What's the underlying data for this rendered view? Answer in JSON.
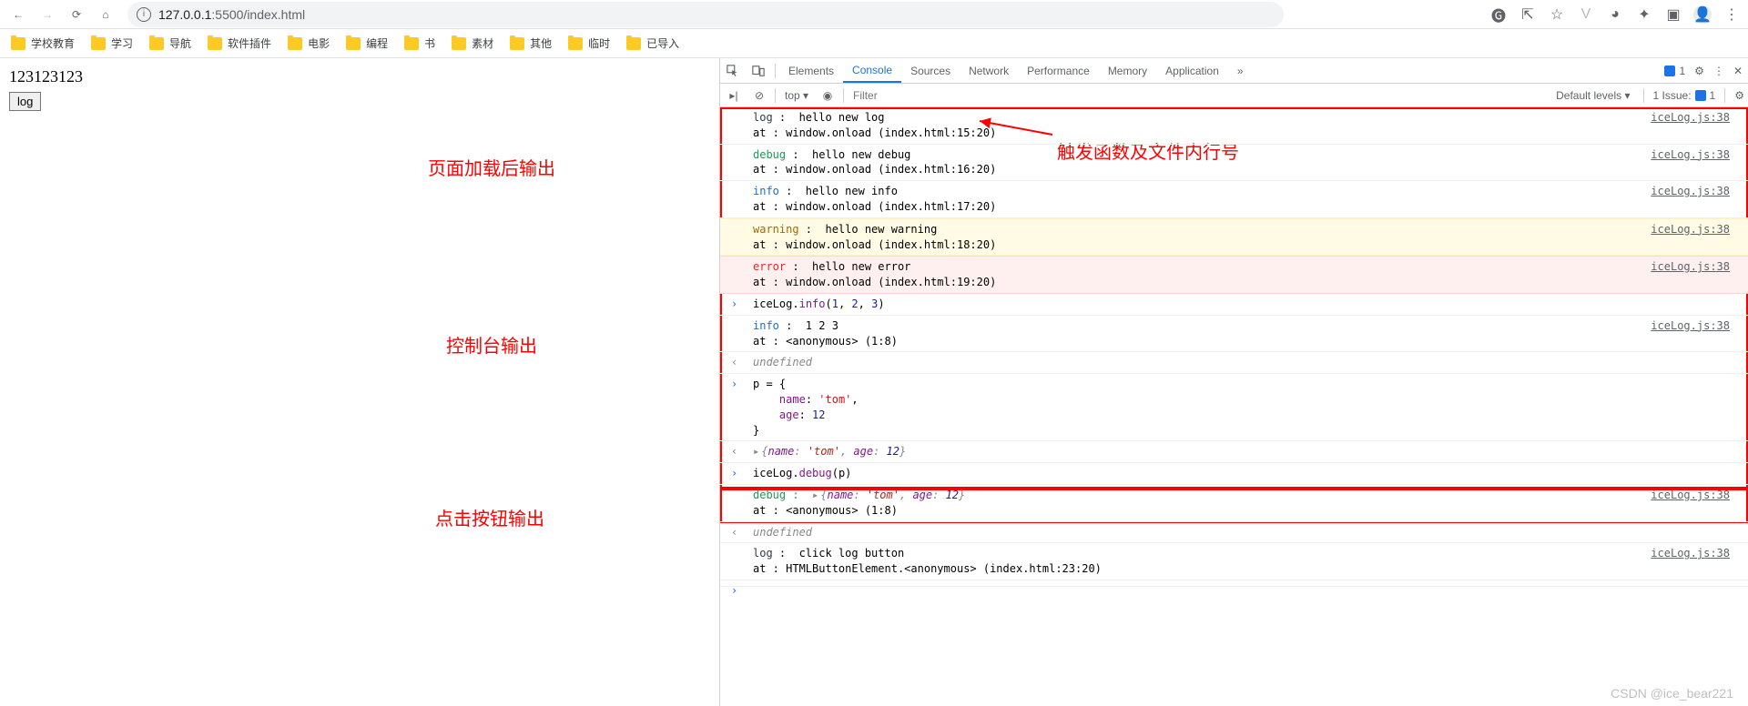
{
  "browser": {
    "url_prefix": "127.0.0.1",
    "url_suffix": ":5500/index.html"
  },
  "bookmarks": [
    "学校教育",
    "学习",
    "导航",
    "软件插件",
    "电影",
    "编程",
    "书",
    "素材",
    "其他",
    "临时",
    "已导入"
  ],
  "page": {
    "text": "123123123",
    "button": "log"
  },
  "annotations": {
    "a1": "页面加载后输出",
    "a2": "触发函数及文件内行号",
    "a3": "控制台输出",
    "a4": "点击按钮输出"
  },
  "devtools": {
    "tabs": [
      "Elements",
      "Console",
      "Sources",
      "Network",
      "Performance",
      "Memory",
      "Application"
    ],
    "active_tab": "Console",
    "badge_count": "1",
    "issue_count": "1 Issue:",
    "issue_num": "1",
    "top": "top",
    "filter_placeholder": "Filter",
    "levels": "Default levels"
  },
  "console_lines": [
    {
      "type": "out",
      "level": "log",
      "line1": "log :  hello new log",
      "line2": "at : window.onload (index.html:15:20)",
      "src": "iceLog.js:38"
    },
    {
      "type": "out",
      "level": "debug",
      "line1": "debug :  hello new debug",
      "line2": "at : window.onload (index.html:16:20)",
      "src": "iceLog.js:38"
    },
    {
      "type": "out",
      "level": "info",
      "line1": "info :  hello new info",
      "line2": "at : window.onload (index.html:17:20)",
      "src": "iceLog.js:38"
    },
    {
      "type": "out",
      "level": "warn",
      "line1": "warning :  hello new warning",
      "line2": "at : window.onload (index.html:18:20)",
      "src": "iceLog.js:38"
    },
    {
      "type": "out",
      "level": "err",
      "line1": "error :  hello new error",
      "line2": "at : window.onload (index.html:19:20)",
      "src": "iceLog.js:38"
    },
    {
      "type": "in",
      "text": "iceLog.info(1, 2, 3)"
    },
    {
      "type": "out",
      "level": "info",
      "line1": "info :  1 2 3",
      "line2": "at : <anonymous> (1:8)",
      "src": "iceLog.js:38"
    },
    {
      "type": "ret",
      "text": "undefined"
    },
    {
      "type": "in",
      "text": "p = {\n    name: 'tom',\n    age: 12\n}"
    },
    {
      "type": "retobj",
      "text": "{name: 'tom', age: 12}"
    },
    {
      "type": "in",
      "text": "iceLog.debug(p)"
    },
    {
      "type": "outobj",
      "level": "debug",
      "prefix": "debug : ",
      "obj": "{name: 'tom', age: 12}",
      "line2": "at : <anonymous> (1:8)",
      "src": "iceLog.js:38"
    },
    {
      "type": "ret",
      "text": "undefined"
    },
    {
      "type": "out",
      "level": "log",
      "line1": "log :  click log button",
      "line2": "at : HTMLButtonElement.<anonymous> (index.html:23:20)",
      "src": "iceLog.js:38"
    },
    {
      "type": "prompt"
    }
  ],
  "watermark": "CSDN @ice_bear221"
}
